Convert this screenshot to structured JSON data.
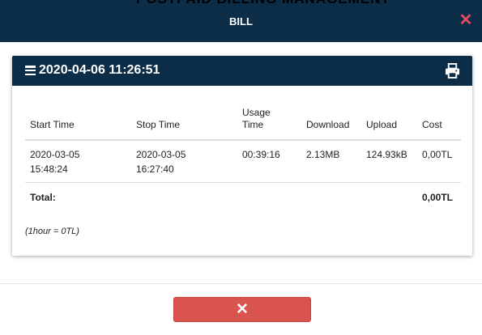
{
  "background": {
    "partial_title": "POSTPAID BILLING MANAGEMENT"
  },
  "modal": {
    "title": "BILL",
    "close_glyph": "✕",
    "header_color": "#0c2d48",
    "close_color": "#e84b5d"
  },
  "card": {
    "title": "2020-04-06 11:26:51",
    "menu_icon": "hamburger-icon",
    "print_icon": "print-icon"
  },
  "table": {
    "headers": [
      "Start Time",
      "Stop Time",
      "Usage Time",
      "Download",
      "Upload",
      "Cost"
    ],
    "rows": [
      {
        "start": "2020-03-05 15:48:24",
        "stop": "2020-03-05 16:27:40",
        "usage": "00:39:16",
        "download": "2.13MB",
        "upload": "124.93kB",
        "cost": "0,00TL"
      }
    ],
    "total_label": "Total:",
    "total_value": "0,00TL"
  },
  "note": "(1hour = 0TL)",
  "footer": {
    "close_glyph": "✕",
    "button_color": "#d9534f"
  }
}
